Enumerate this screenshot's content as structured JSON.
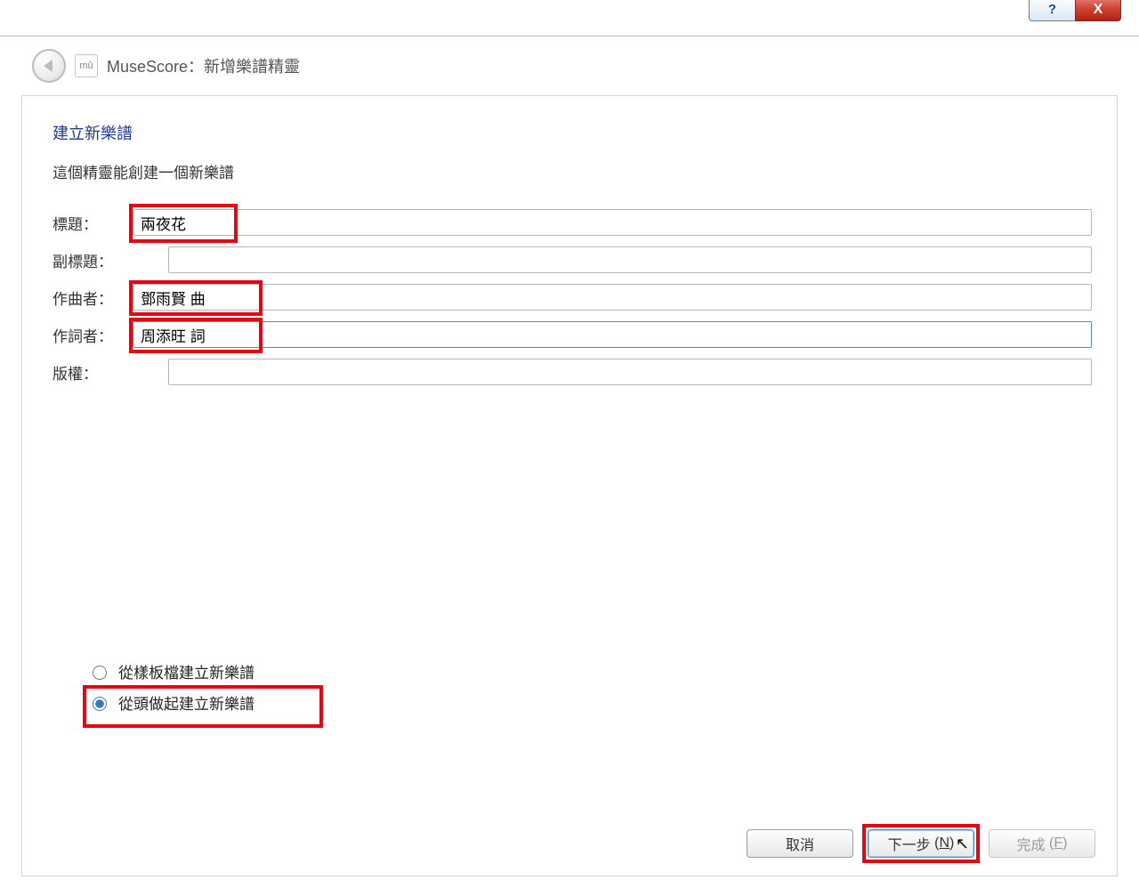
{
  "titlebar": {
    "help_tooltip": "?",
    "close_tooltip": "X"
  },
  "header": {
    "app_icon_text": "mû",
    "title": "MuseScore：新增樂譜精靈"
  },
  "wizard": {
    "heading": "建立新樂譜",
    "subtext": "這個精靈能創建一個新樂譜",
    "fields": {
      "title_label": "標題：",
      "title_value": "兩夜花",
      "subtitle_label": "副標題：",
      "subtitle_value": "",
      "composer_label": "作曲者：",
      "composer_value": "鄧雨賢 曲",
      "lyricist_label": "作詞者：",
      "lyricist_value": "周添旺 詞",
      "copyright_label": "版權：",
      "copyright_value": ""
    },
    "radios": {
      "from_template": "從樣板檔建立新樂譜",
      "from_scratch": "從頭做起建立新樂譜",
      "selected": "from_scratch"
    },
    "buttons": {
      "cancel": "取消",
      "next": "下一步",
      "next_accelerator": "N",
      "finish": "完成",
      "finish_accelerator": "F"
    }
  }
}
